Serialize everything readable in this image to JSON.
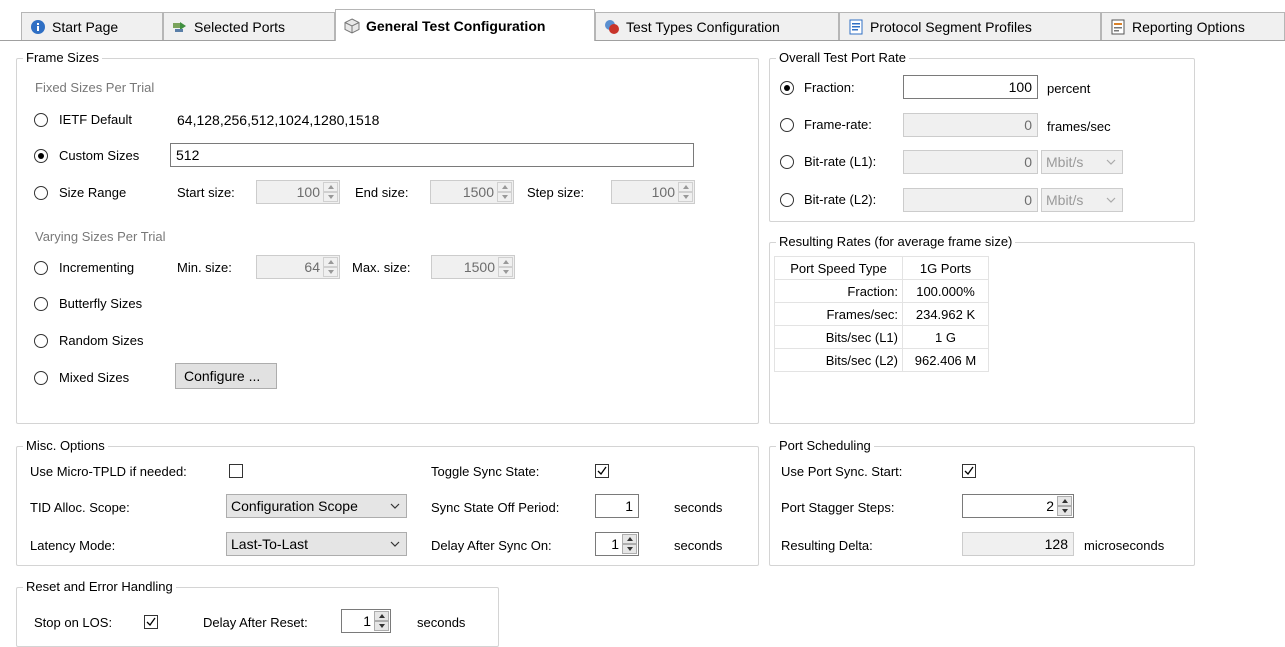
{
  "tabs": [
    {
      "label": "Start Page",
      "icon": "info-icon"
    },
    {
      "label": "Selected Ports",
      "icon": "ports-icon"
    },
    {
      "label": "General Test Configuration",
      "icon": "cube-icon"
    },
    {
      "label": "Test Types Configuration",
      "icon": "test-types-icon"
    },
    {
      "label": "Protocol Segment Profiles",
      "icon": "document-icon"
    },
    {
      "label": "Reporting Options",
      "icon": "report-icon"
    }
  ],
  "active_tab": "General Test Configuration",
  "frame_sizes": {
    "title": "Frame Sizes",
    "fixed_title": "Fixed Sizes Per Trial",
    "ietf_label": "IETF Default",
    "ietf_value": "64,128,256,512,1024,1280,1518",
    "custom_label": "Custom Sizes",
    "custom_value": "512",
    "range_label": "Size Range",
    "start_label": "Start size:",
    "start_value": "100",
    "end_label": "End size:",
    "end_value": "1500",
    "step_label": "Step size:",
    "step_value": "100",
    "varying_title": "Varying Sizes Per Trial",
    "incrementing_label": "Incrementing",
    "min_label": "Min. size:",
    "min_value": "64",
    "max_label": "Max. size:",
    "max_value": "1500",
    "butterfly_label": "Butterfly Sizes",
    "random_label": "Random Sizes",
    "mixed_label": "Mixed Sizes",
    "configure_label": "Configure ...",
    "selected": "Custom Sizes"
  },
  "port_rate": {
    "title": "Overall Test Port Rate",
    "fraction_label": "Fraction:",
    "fraction_value": "100",
    "fraction_unit": "percent",
    "framerate_label": "Frame-rate:",
    "framerate_value": "0",
    "framerate_unit": "frames/sec",
    "bitrate_l1_label": "Bit-rate (L1):",
    "bitrate_l1_value": "0",
    "bitrate_l1_unit": "Mbit/s",
    "bitrate_l2_label": "Bit-rate (L2):",
    "bitrate_l2_value": "0",
    "bitrate_l2_unit": "Mbit/s",
    "selected": "Fraction:"
  },
  "resulting_rates": {
    "title": "Resulting Rates (for average frame size)",
    "rows": [
      {
        "key": "Port Speed Type",
        "value": "1G Ports"
      },
      {
        "key": "Fraction:",
        "value": "100.000%"
      },
      {
        "key": "Frames/sec:",
        "value": "234.962 K"
      },
      {
        "key": "Bits/sec (L1)",
        "value": "1 G"
      },
      {
        "key": "Bits/sec (L2)",
        "value": "962.406 M"
      }
    ]
  },
  "misc": {
    "title": "Misc. Options",
    "micro_tpld_label": "Use Micro-TPLD if needed:",
    "micro_tpld_checked": false,
    "tid_label": "TID Alloc. Scope:",
    "tid_value": "Configuration Scope",
    "latency_label": "Latency Mode:",
    "latency_value": "Last-To-Last",
    "toggle_sync_label": "Toggle Sync State:",
    "toggle_sync_checked": true,
    "sync_off_label": "Sync State Off Period:",
    "sync_off_value": "1",
    "sync_off_unit": "seconds",
    "delay_sync_label": "Delay After Sync On:",
    "delay_sync_value": "1",
    "delay_sync_unit": "seconds"
  },
  "port_scheduling": {
    "title": "Port Scheduling",
    "sync_start_label": "Use Port Sync. Start:",
    "sync_start_checked": true,
    "stagger_label": "Port Stagger Steps:",
    "stagger_value": "2",
    "delta_label": "Resulting Delta:",
    "delta_value": "128",
    "delta_unit": "microseconds"
  },
  "reset": {
    "title": "Reset and Error Handling",
    "stop_los_label": "Stop on LOS:",
    "stop_los_checked": true,
    "delay_reset_label": "Delay After Reset:",
    "delay_reset_value": "1",
    "delay_reset_unit": "seconds"
  },
  "colors": {
    "info_icon": "#2f6fc4",
    "ports_icon": "#3f8f3f",
    "test_types_icon": "#c8342a",
    "document_icon": "#2f6fc4",
    "report_icon": "#d9822b"
  }
}
